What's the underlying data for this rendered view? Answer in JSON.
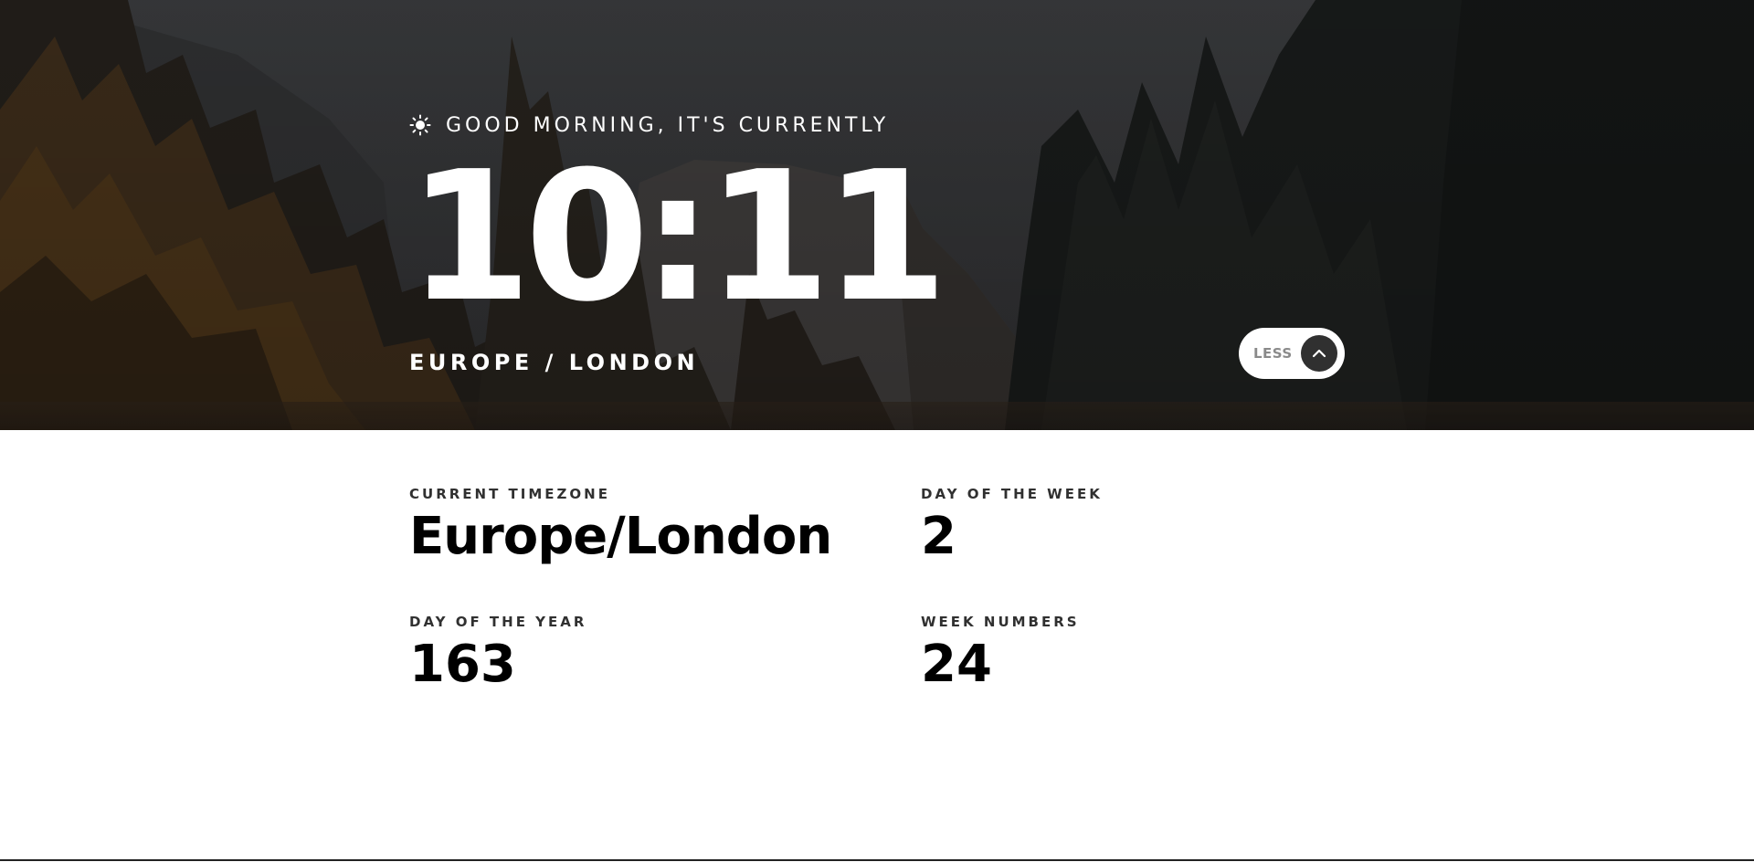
{
  "hero": {
    "greeting": "GOOD MORNING, IT'S CURRENTLY",
    "greeting_icon": "sun-icon",
    "time": "10:11",
    "location": "EUROPE / LONDON",
    "toggle_label": "LESS",
    "toggle_icon": "chevron-up-icon"
  },
  "details": {
    "timezone_label": "CURRENT TIMEZONE",
    "timezone_value": "Europe/London",
    "day_of_week_label": "DAY OF THE WEEK",
    "day_of_week_value": "2",
    "day_of_year_label": "DAY OF THE YEAR",
    "day_of_year_value": "163",
    "week_number_label": "WEEK NUMBERS",
    "week_number_value": "24"
  },
  "colors": {
    "toggle_bg": "#ffffff",
    "toggle_circle": "#303030",
    "text_light": "#ffffff",
    "text_dark": "#000000"
  }
}
